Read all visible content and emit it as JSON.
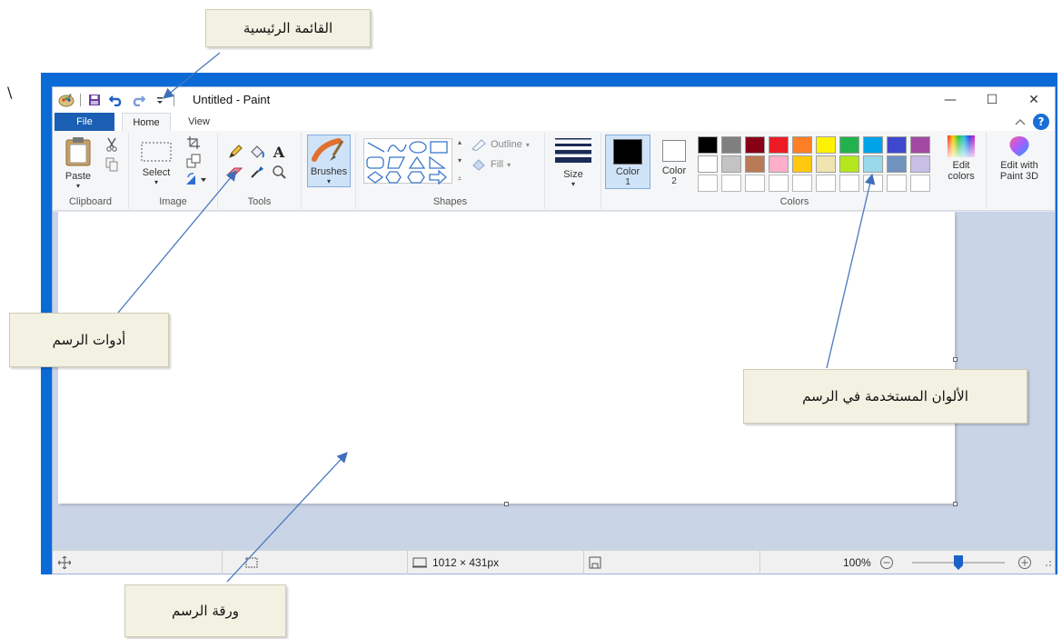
{
  "annotations": {
    "main_menu": "القائمة الرئيسية",
    "drawing_tools": "أدوات الرسم",
    "colors_used": "الألوان المستخدمة في الرسم",
    "drawing_paper": "ورقة الرسم",
    "stray_char": "\\"
  },
  "window": {
    "title": "Untitled - Paint",
    "minimize_symbol": "—",
    "maximize_symbol": "☐",
    "close_symbol": "✕"
  },
  "tabs": {
    "file": "File",
    "home": "Home",
    "view": "View"
  },
  "ribbon": {
    "clipboard": {
      "paste": "Paste",
      "label": "Clipboard"
    },
    "image": {
      "select": "Select",
      "label": "Image"
    },
    "tools": {
      "label": "Tools"
    },
    "brushes": {
      "label": "Brushes"
    },
    "shapes": {
      "outline": "Outline",
      "fill": "Fill",
      "label": "Shapes"
    },
    "size": {
      "label": "Size"
    },
    "color1": {
      "label": "Color",
      "num": "1"
    },
    "color2": {
      "label": "Color",
      "num": "2"
    },
    "colors": {
      "label": "Colors"
    },
    "edit_colors": {
      "line1": "Edit",
      "line2": "colors"
    },
    "edit_paint3d": {
      "line1": "Edit with",
      "line2": "Paint 3D"
    }
  },
  "palette": {
    "row1": [
      "#000000",
      "#7f7f7f",
      "#880015",
      "#ed1c24",
      "#ff7f27",
      "#fff200",
      "#22b14c",
      "#00a2e8",
      "#3f48cc",
      "#a349a4"
    ],
    "row2": [
      "#ffffff",
      "#c3c3c3",
      "#b97a57",
      "#ffaec9",
      "#ffc90e",
      "#efe4b0",
      "#b5e61d",
      "#99d9ea",
      "#7092be",
      "#c8bfe7"
    ],
    "row3": [
      "#ffffff",
      "#ffffff",
      "#ffffff",
      "#ffffff",
      "#ffffff",
      "#ffffff",
      "#ffffff",
      "#ffffff",
      "#ffffff",
      "#ffffff"
    ]
  },
  "status": {
    "dimensions": "1012 × 431px",
    "zoom": "100%",
    "zoom_level": 0.5
  }
}
